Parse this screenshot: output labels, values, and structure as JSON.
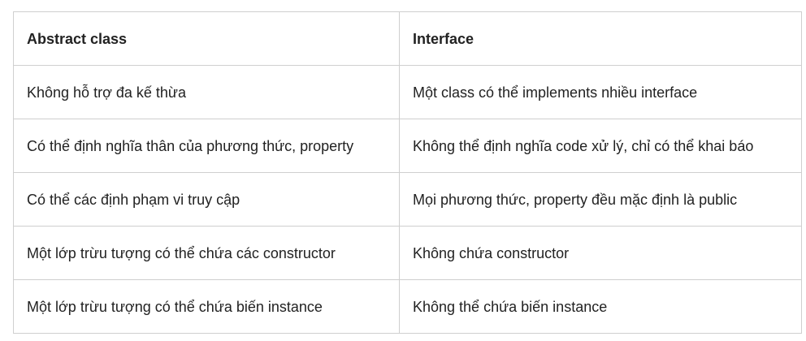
{
  "table": {
    "headers": [
      "Abstract class",
      "Interface"
    ],
    "rows": [
      [
        "Không hỗ trợ đa kế thừa",
        "Một class có thể implements nhiều interface"
      ],
      [
        "Có thể định nghĩa thân của phương thức, property",
        "Không thể định nghĩa code xử lý, chỉ có thể khai báo"
      ],
      [
        "Có thể các định phạm vi truy cập",
        "Mọi phương thức, property đều mặc định là public"
      ],
      [
        "Một lớp trừu tượng có thể chứa các constructor",
        "Không chứa constructor"
      ],
      [
        "Một lớp trừu tượng có thể chứa biến instance",
        "Không thể chứa biến instance"
      ]
    ]
  }
}
